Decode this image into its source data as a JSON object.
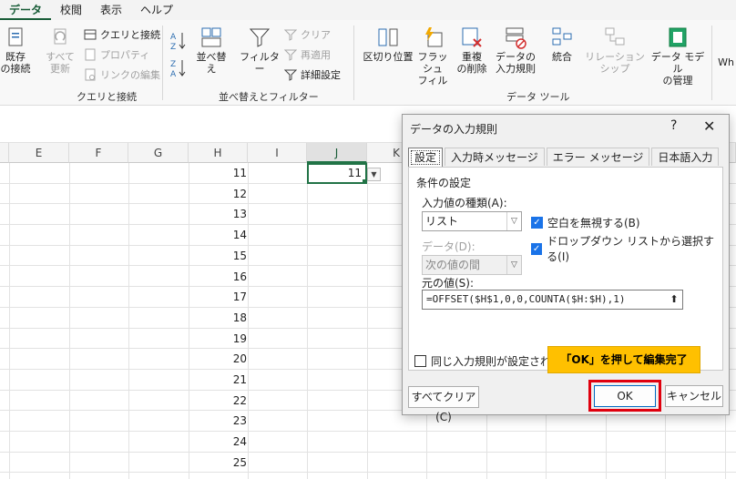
{
  "ribbon_tabs": [
    "データ",
    "校閲",
    "表示",
    "ヘルプ"
  ],
  "ribbon": {
    "existing_connections": "既存\nの接続",
    "refresh_all": "すべて\n更新",
    "queries_connections": "クエリと接続",
    "properties": "プロパティ",
    "edit_links": "リンクの編集",
    "group_queries": "クエリと接続",
    "sort": "並べ替え",
    "filter": "フィルター",
    "clear": "クリア",
    "reapply": "再適用",
    "advanced": "詳細設定",
    "group_sort": "並べ替えとフィルター",
    "text_to_columns": "区切り位置",
    "flash_fill": "フラッシュ\nフィル",
    "remove_duplicates": "重複\nの削除",
    "data_validation": "データの\n入力規則",
    "consolidate": "統合",
    "relationships": "リレーションシップ",
    "data_model": "データ モデル\nの管理",
    "what_if": "Wh",
    "group_tools": "データ ツール"
  },
  "columns": [
    "E",
    "F",
    "G",
    "H",
    "I",
    "J",
    "K"
  ],
  "h_values": [
    "11",
    "12",
    "13",
    "14",
    "15",
    "16",
    "17",
    "18",
    "19",
    "20",
    "21",
    "22",
    "23",
    "24",
    "25"
  ],
  "active_cell": {
    "column": "J",
    "value": "11"
  },
  "dialog": {
    "title": "データの入力規則",
    "help": "?",
    "close": "✕",
    "tabs": [
      "設定",
      "入力時メッセージ",
      "エラー メッセージ",
      "日本語入力"
    ],
    "criteria_heading": "条件の設定",
    "allow_label": "入力値の種類(A):",
    "allow_value": "リスト",
    "data_label": "データ(D):",
    "data_value": "次の値の間",
    "ignore_blank": {
      "label": "空白を無視する(B)",
      "checked": true
    },
    "in_cell_dropdown": {
      "label": "ドロップダウン リストから選択する(I)",
      "checked": true
    },
    "source_label": "元の値(S):",
    "source_value": "=OFFSET($H$1,0,0,COUNTA($H:$H),1)",
    "apply_all_label": "同じ入力規則が設定されたすべ",
    "apply_all_checked": false,
    "annotation": "「OK」を押して編集完了",
    "clear_all": "すべてクリア(C)",
    "ok": "OK",
    "cancel": "キャンセル"
  }
}
